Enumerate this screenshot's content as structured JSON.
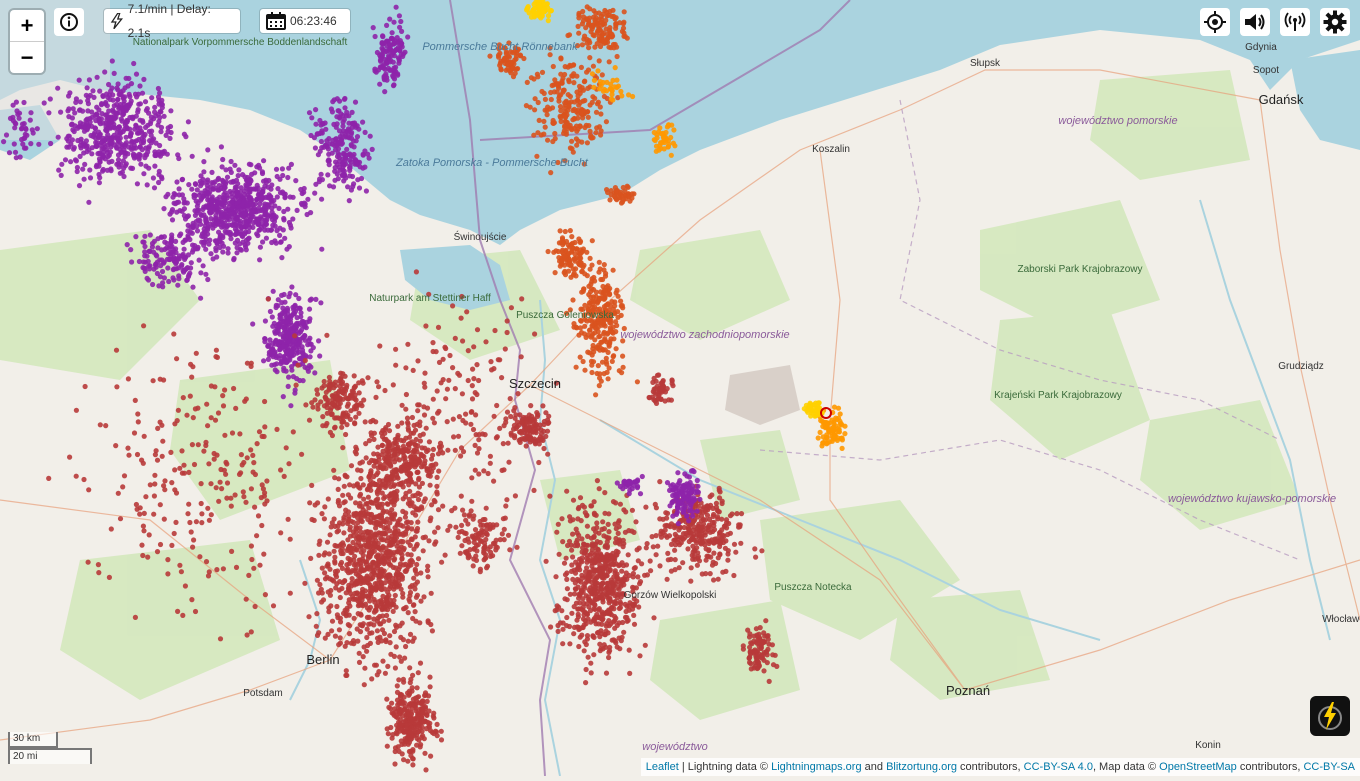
{
  "map": {
    "cities": [
      {
        "name": "Szczecin",
        "kind": "city"
      },
      {
        "name": "Berlin",
        "kind": "city"
      },
      {
        "name": "Poznań",
        "kind": "city"
      },
      {
        "name": "Gdańsk",
        "kind": "city"
      },
      {
        "name": "Koszalin",
        "kind": "town"
      },
      {
        "name": "Słupsk",
        "kind": "town"
      },
      {
        "name": "Gdynia",
        "kind": "town"
      },
      {
        "name": "Sopot",
        "kind": "town"
      },
      {
        "name": "Świnoujście",
        "kind": "town"
      },
      {
        "name": "Potsdam",
        "kind": "town"
      },
      {
        "name": "Grudziądz",
        "kind": "town"
      },
      {
        "name": "Konin",
        "kind": "town"
      },
      {
        "name": "Włocławek",
        "kind": "town"
      },
      {
        "name": "Gorzów Wielkopolski",
        "kind": "town"
      }
    ],
    "regions": [
      {
        "name": "województwo pomorskie"
      },
      {
        "name": "województwo zachodniopomorskie"
      },
      {
        "name": "województwo kujawsko-pomorskie"
      },
      {
        "name": "województwo"
      }
    ],
    "parks": [
      {
        "name": "Zaborski Park Krajobrazowy"
      },
      {
        "name": "Krajeński Park Krajobrazowy"
      },
      {
        "name": "Puszcza Notecka"
      },
      {
        "name": "Naturpark am Stettiner Haff"
      },
      {
        "name": "Nationalpark Vorpommersche Boddenlandschaft"
      },
      {
        "name": "Puszcza Goleniowska"
      }
    ],
    "water": [
      {
        "name": "Zatoka Pomorska - Pommersche Bucht"
      },
      {
        "name": "Pommersche Bucht Rönnebank"
      }
    ]
  },
  "controls": {
    "zoom_in": "+",
    "zoom_out": "−",
    "info_icon": "info-icon",
    "rate_text": "7.1/min | Delay: 2.1s",
    "time_text": "06:23:46",
    "right_icons": [
      "locate-icon",
      "sound-icon",
      "signal-icon",
      "gear-icon"
    ]
  },
  "scale": {
    "km": "30 km",
    "mi": "20 mi"
  },
  "attribution": {
    "leaflet": "Leaflet",
    "sep": " | Lightning data © ",
    "lm": "Lightningmaps.org",
    "and": " and ",
    "bo": "Blitzortung.org",
    "contrib": " contributors, ",
    "cc1": "CC-BY-SA 4.0",
    "mapdata": ", Map data © ",
    "osm": "OpenStreetMap",
    "contrib2": " contributors, ",
    "cc2": "CC-BY-SA"
  },
  "colors": {
    "strike_old": "#8e24aa",
    "strike_mid": "#b83a3a",
    "strike_recent": "#d9531e",
    "strike_new": "#ff9800",
    "strike_newest": "#ffd000",
    "sea": "#aad3df",
    "land": "#f2efe9",
    "forest": "#cfe5b8"
  }
}
